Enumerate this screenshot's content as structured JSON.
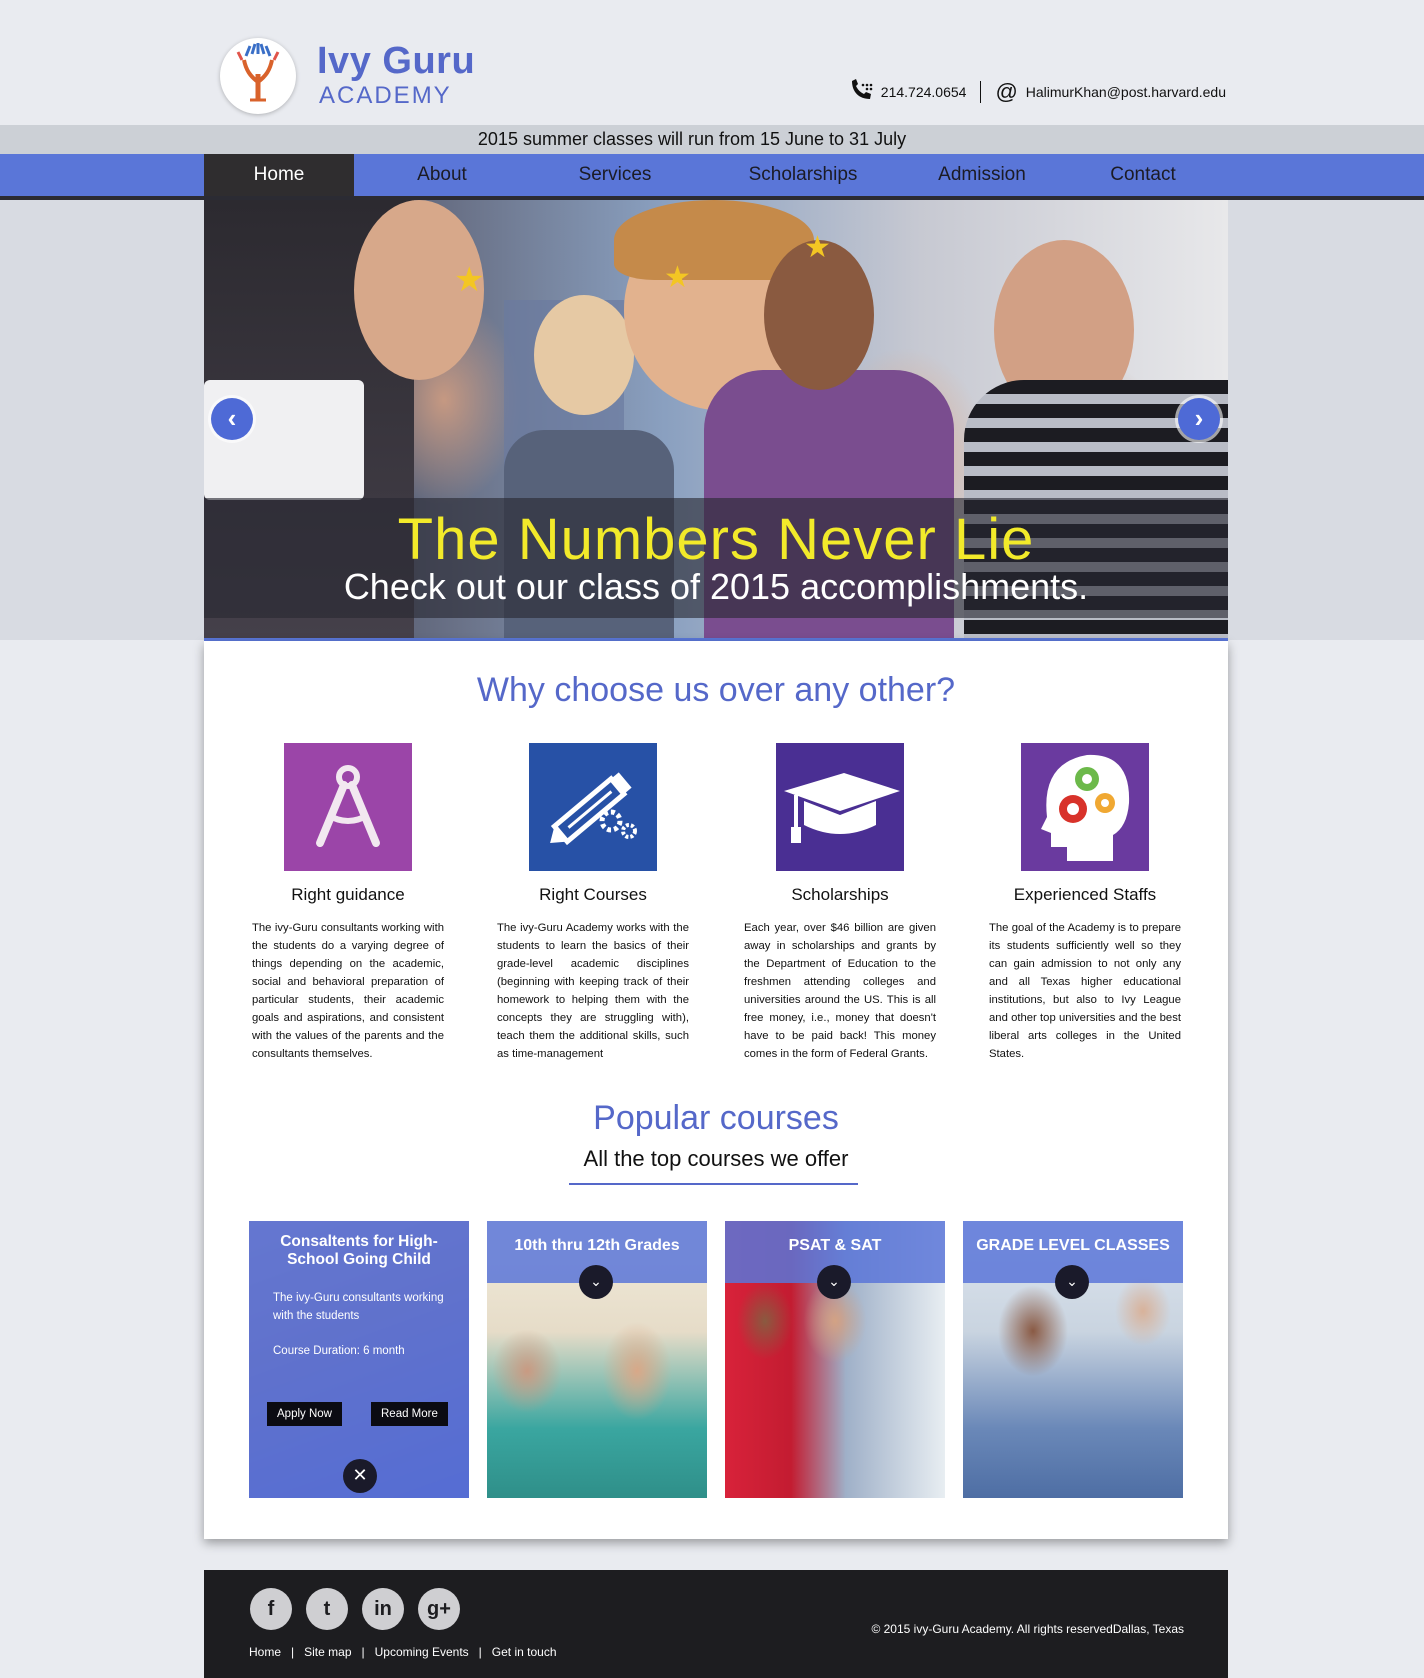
{
  "header": {
    "logo_title": "Ivy Guru",
    "logo_sub": "ACADEMY",
    "phone": "214.724.0654",
    "email": "HalimurKhan@post.harvard.edu",
    "notice": "2015 summer classes will run from 15 June to 31 July"
  },
  "nav": {
    "items": [
      "Home",
      "About",
      "Services",
      "Scholarships",
      "Admission",
      "Contact"
    ],
    "active": "Home"
  },
  "hero": {
    "title": "The Numbers Never Lie",
    "subtitle": "Check out our class of 2015 accomplishments.",
    "prev_icon": "‹",
    "next_icon": "›"
  },
  "why": {
    "title": "Why choose us over any other?",
    "features": [
      {
        "title": "Right guidance",
        "icon": "compass-icon",
        "color": "#9b45a8",
        "text": "The ivy-Guru consultants working with the students do a varying degree of things depending on the academic, social and behavioral preparation of particular students, their academic goals and aspirations, and consistent with the values of the parents and the consultants themselves."
      },
      {
        "title": "Right Courses",
        "icon": "pencil-gears-icon",
        "color": "#2751a6",
        "text": "The ivy-Guru Academy works with the students to learn the basics of their grade-level academic disciplines (beginning with keeping track of their homework to helping them with the concepts they are struggling with), teach them the additional skills, such as time-management"
      },
      {
        "title": "Scholarships",
        "icon": "graduation-cap-icon",
        "color": "#4a2f93",
        "text": "Each year, over $46 billion are given away in scholarships and grants by the Department of Education to the freshmen attending colleges and universities around the US. This is all free money, i.e., money that doesn't have to be paid back! This money comes in the form of Federal Grants."
      },
      {
        "title": "Experienced Staffs",
        "icon": "head-gears-icon",
        "color": "#6a3a9f",
        "text": "The goal of the Academy is to prepare its students sufficiently well so they can gain admission to not only any and all Texas higher educational institutions, but also to Ivy League and other top universities and the best liberal arts colleges in the United States."
      }
    ]
  },
  "popular": {
    "title": "Popular courses",
    "subtitle": "All the top courses we offer",
    "courses": [
      {
        "title": "Consaltents for High-School Going Child",
        "description": "The ivy-Guru consultants working with the students",
        "duration": "Course Duration: 6 month",
        "apply_label": "Apply Now",
        "read_label": "Read More"
      },
      {
        "title": "10th thru 12th Grades"
      },
      {
        "title": "PSAT & SAT"
      },
      {
        "title": "GRADE LEVEL CLASSES"
      }
    ]
  },
  "footer": {
    "social": [
      "f",
      "t",
      "in",
      "g+"
    ],
    "links": [
      "Home",
      "Site map",
      "Upcoming Events",
      "Get in touch"
    ],
    "copyright": "© 2015 ivy-Guru Academy. All rights reservedDallas, Texas"
  },
  "colors": {
    "accent": "#5568c9",
    "nav": "#5a76d8",
    "hero_title": "#f2ea2a",
    "footer_bg": "#1d1d20"
  }
}
